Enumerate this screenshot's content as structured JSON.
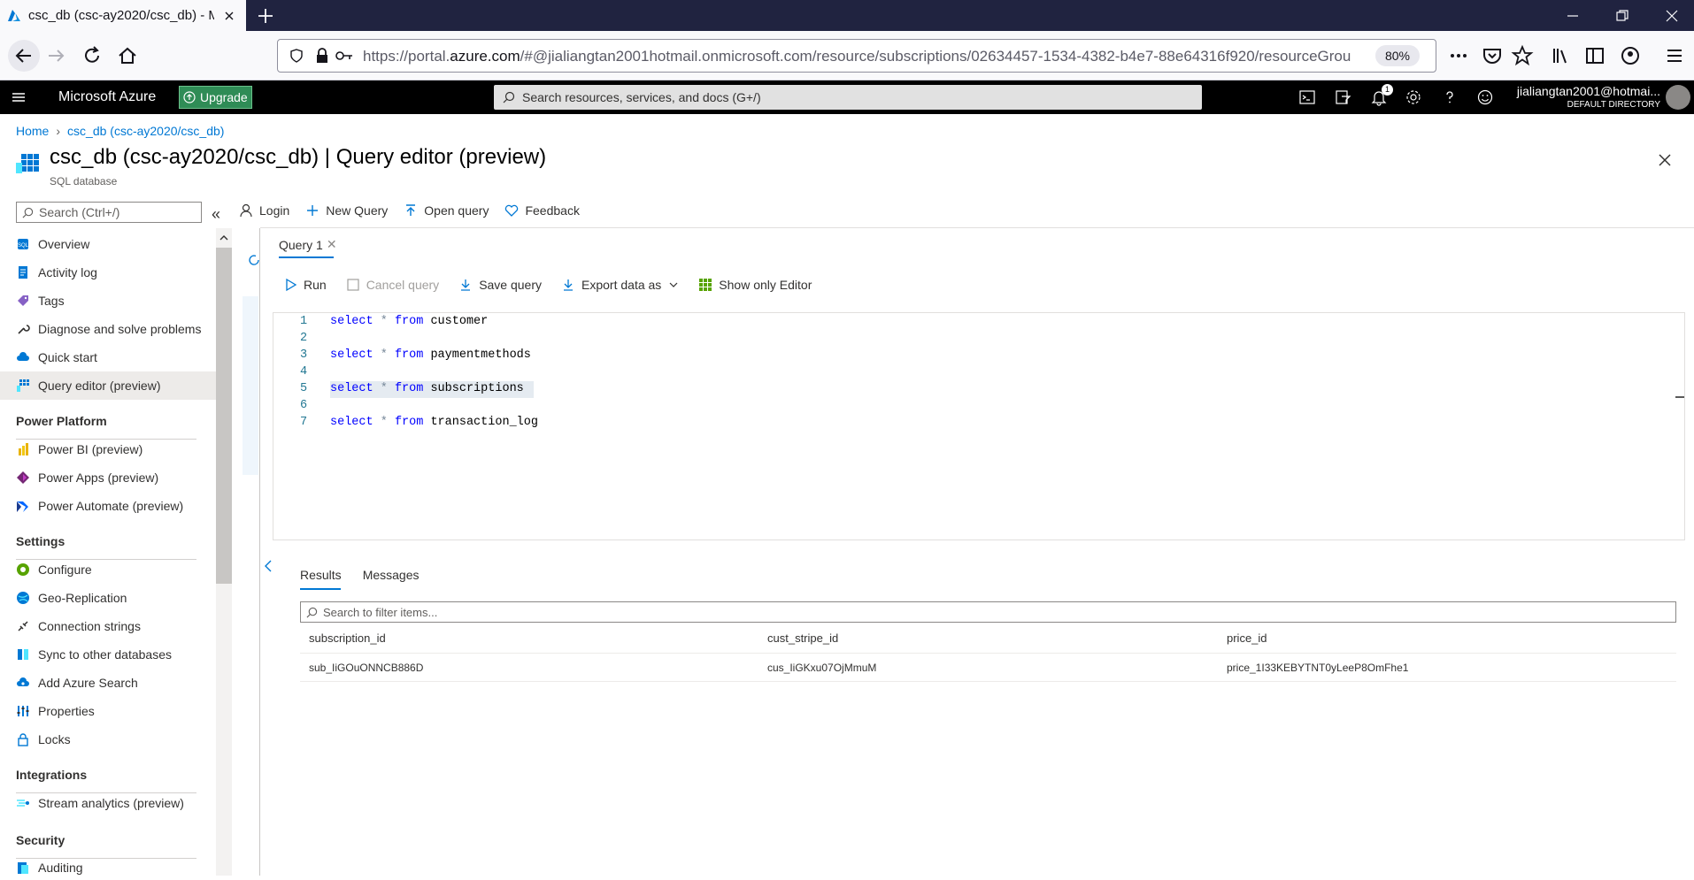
{
  "browser": {
    "tab_title": "csc_db (csc-ay2020/csc_db) - M",
    "url_prefix": "https://portal.",
    "url_domain": "azure.com",
    "url_rest": "/#@jialiangtan2001hotmail.onmicrosoft.com/resource/subscriptions/02634457-1534-4382-b4e7-88e64316f920/resourceGrou",
    "zoom": "80%"
  },
  "azure_header": {
    "brand": "Microsoft Azure",
    "upgrade_label": "Upgrade",
    "search_placeholder": "Search resources, services, and docs (G+/)",
    "notification_count": "1",
    "user_name": "jialiangtan2001@hotmai...",
    "directory": "DEFAULT DIRECTORY"
  },
  "breadcrumb": {
    "home": "Home",
    "current": "csc_db (csc-ay2020/csc_db)"
  },
  "page": {
    "title": "csc_db (csc-ay2020/csc_db) | Query editor (preview)",
    "subtitle": "SQL database"
  },
  "sidebar": {
    "search_placeholder": "Search (Ctrl+/)",
    "items": [
      {
        "label": "Overview",
        "icon": "sql-icon"
      },
      {
        "label": "Activity log",
        "icon": "activity-log-icon"
      },
      {
        "label": "Tags",
        "icon": "tag-icon"
      },
      {
        "label": "Diagnose and solve problems",
        "icon": "wrench-icon"
      },
      {
        "label": "Quick start",
        "icon": "cloud-icon"
      },
      {
        "label": "Query editor (preview)",
        "icon": "grid-icon"
      }
    ],
    "power_platform": {
      "heading": "Power Platform",
      "items": [
        {
          "label": "Power BI (preview)",
          "icon": "power-bi-icon"
        },
        {
          "label": "Power Apps (preview)",
          "icon": "power-apps-icon"
        },
        {
          "label": "Power Automate (preview)",
          "icon": "power-automate-icon"
        }
      ]
    },
    "settings": {
      "heading": "Settings",
      "items": [
        {
          "label": "Configure",
          "icon": "configure-icon"
        },
        {
          "label": "Geo-Replication",
          "icon": "globe-icon"
        },
        {
          "label": "Connection strings",
          "icon": "link-icon"
        },
        {
          "label": "Sync to other databases",
          "icon": "sync-icon"
        },
        {
          "label": "Add Azure Search",
          "icon": "cloud-search-icon"
        },
        {
          "label": "Properties",
          "icon": "properties-icon"
        },
        {
          "label": "Locks",
          "icon": "lock-icon"
        }
      ]
    },
    "integrations": {
      "heading": "Integrations",
      "items": [
        {
          "label": "Stream analytics (preview)",
          "icon": "stream-icon"
        }
      ]
    },
    "security": {
      "heading": "Security",
      "items": [
        {
          "label": "Auditing",
          "icon": "auditing-icon"
        }
      ]
    }
  },
  "toolbar": {
    "login": "Login",
    "new_query": "New Query",
    "open_query": "Open query",
    "feedback": "Feedback"
  },
  "query": {
    "tab_label": "Query 1",
    "run": "Run",
    "cancel": "Cancel query",
    "save": "Save query",
    "export": "Export data as",
    "show_editor": "Show only Editor",
    "lines": [
      {
        "num": "1",
        "kw1": "select",
        "op": "*",
        "kw2": "from",
        "table": "customer"
      },
      {
        "num": "2"
      },
      {
        "num": "3",
        "kw1": "select",
        "op": "*",
        "kw2": "from",
        "table": "paymentmethods"
      },
      {
        "num": "4"
      },
      {
        "num": "5",
        "kw1": "select",
        "op": "*",
        "kw2": "from",
        "table": "subscriptions"
      },
      {
        "num": "6"
      },
      {
        "num": "7",
        "kw1": "select",
        "op": "*",
        "kw2": "from",
        "table": "transaction_log"
      }
    ]
  },
  "results": {
    "tab_results": "Results",
    "tab_messages": "Messages",
    "filter_placeholder": "Search to filter items...",
    "columns": [
      "subscription_id",
      "cust_stripe_id",
      "price_id"
    ],
    "rows": [
      [
        "sub_IiGOuONNCB886D",
        "cus_IiGKxu07OjMmuM",
        "price_1I33KEBYTNT0yLeeP8OmFhe1"
      ]
    ]
  },
  "colors": {
    "accent": "#0078d4",
    "header_bg": "#000000",
    "upgrade_bg": "#2f8c56",
    "tabbar_bg": "#202340"
  }
}
